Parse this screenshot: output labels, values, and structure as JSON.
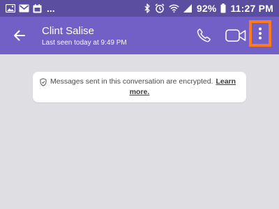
{
  "status_bar": {
    "icons_left": [
      "image-icon",
      "gmail-icon",
      "calendar-icon"
    ],
    "overflow": "...",
    "icons_right": [
      "bluetooth-icon",
      "alarm-icon",
      "wifi-icon",
      "signal-icon",
      "battery-icon"
    ],
    "battery_percent": "92%",
    "time": "11:27 PM"
  },
  "header": {
    "contact_name": "Clint Salise",
    "last_seen": "Last seen today at 9:49 PM",
    "actions": [
      "back-arrow-icon",
      "phone-icon",
      "video-camera-icon",
      "more-vert-icon"
    ]
  },
  "notice": {
    "text": "Messages sent in this conversation are encrypted.",
    "link_part1": "Learn",
    "link_part2": "more."
  },
  "colors": {
    "status_bar_bg": "#5b4ea1",
    "app_bar_bg": "#7360c6",
    "chat_bg": "#dfdfe3",
    "highlight": "#ff7a1a"
  }
}
